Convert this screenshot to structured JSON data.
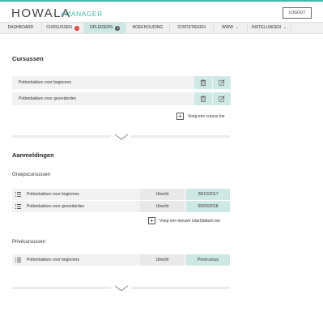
{
  "header": {
    "logo_text": "HOWALA",
    "app_name": "eMANAGER",
    "logout_label": "LOGOUT",
    "accent_color": "#3fb8ad"
  },
  "nav": {
    "items": [
      {
        "label": "DASHBOARD"
      },
      {
        "label": "CURSUSSEN",
        "badge": "5"
      },
      {
        "label": "OPLEIDERS",
        "badge": "3"
      },
      {
        "label": "BOEKHOUDING"
      },
      {
        "label": "STATISTIEKEN"
      },
      {
        "label": "WWW"
      },
      {
        "label": "INSTELLINGEN"
      }
    ]
  },
  "courses": {
    "title": "Cursussen",
    "items": [
      {
        "label": "Pottenbakken voor beginners"
      },
      {
        "label": "Pottenbakken voor gevorderden"
      }
    ],
    "add_label": "Voeg een cursus toe"
  },
  "registrations": {
    "title": "Aanmeldingen",
    "group_title": "Groepscursussen",
    "group_rows": [
      {
        "name": "Pottenbakken voor beginners",
        "city": "Utrecht",
        "date": "28/12/2017"
      },
      {
        "name": "Pottenbakken voor gevorderden",
        "city": "Utrecht",
        "date": "05/03/2018"
      }
    ],
    "add_date_label": "Voeg een nieuwe (start)datum toe",
    "private_title": "Privécursussen",
    "private_rows": [
      {
        "name": "Pottenbakken voor beginners",
        "city": "Utrecht",
        "tag": "Privécursus"
      }
    ]
  }
}
